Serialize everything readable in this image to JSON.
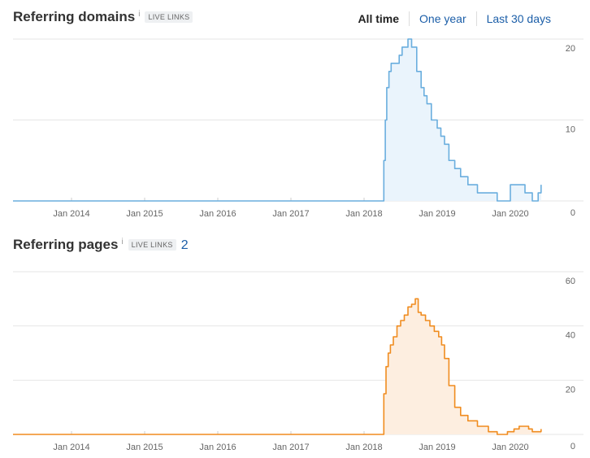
{
  "header": {
    "domains_title": "Referring domains",
    "info_glyph": "i",
    "live_badge": "LIVE LINKS",
    "pages_title": "Referring pages",
    "pages_count": "2"
  },
  "time_range": {
    "options": [
      "All time",
      "One year",
      "Last 30 days"
    ],
    "selected": "All time"
  },
  "chart_data": [
    {
      "type": "area",
      "title": "Referring domains",
      "color": "#6aaede",
      "fill": "#eaf4fc",
      "x_ticks": [
        "Jan 2014",
        "Jan 2015",
        "Jan 2016",
        "Jan 2017",
        "Jan 2018",
        "Jan 2019",
        "Jan 2020"
      ],
      "y_ticks": [
        "0",
        "10",
        "20"
      ],
      "ylim": [
        0,
        20
      ],
      "xlim": [
        2013.2,
        2020.6
      ],
      "grid": true,
      "series": [
        {
          "x": [
            2013.2,
            2018.25,
            2018.27,
            2018.29,
            2018.31,
            2018.34,
            2018.37,
            2018.42,
            2018.48,
            2018.52,
            2018.56,
            2018.6,
            2018.65,
            2018.72,
            2018.78,
            2018.82,
            2018.86,
            2018.92,
            2018.96,
            2019.0,
            2019.05,
            2019.1,
            2019.16,
            2019.24,
            2019.32,
            2019.42,
            2019.55,
            2019.65,
            2019.82,
            2019.95,
            2020.0,
            2020.1,
            2020.2,
            2020.25,
            2020.3,
            2020.35,
            2020.38,
            2020.42
          ],
          "y": [
            0,
            0,
            5,
            10,
            14,
            16,
            17,
            17,
            18,
            19,
            19,
            20,
            19,
            16,
            14,
            13,
            12,
            10,
            10,
            9,
            8,
            7,
            5,
            4,
            3,
            2,
            1,
            1,
            0,
            0,
            2,
            2,
            1,
            1,
            0,
            0,
            1,
            2
          ]
        }
      ]
    },
    {
      "type": "area",
      "title": "Referring pages",
      "color": "#f08c1f",
      "fill": "#fdeee0",
      "x_ticks": [
        "Jan 2014",
        "Jan 2015",
        "Jan 2016",
        "Jan 2017",
        "Jan 2018",
        "Jan 2019",
        "Jan 2020"
      ],
      "y_ticks": [
        "0",
        "20",
        "40",
        "60"
      ],
      "ylim": [
        0,
        60
      ],
      "xlim": [
        2013.2,
        2020.6
      ],
      "grid": true,
      "series": [
        {
          "x": [
            2013.2,
            2018.25,
            2018.27,
            2018.3,
            2018.33,
            2018.36,
            2018.4,
            2018.45,
            2018.5,
            2018.55,
            2018.6,
            2018.65,
            2018.7,
            2018.74,
            2018.78,
            2018.84,
            2018.9,
            2018.96,
            2019.02,
            2019.06,
            2019.1,
            2019.16,
            2019.24,
            2019.32,
            2019.42,
            2019.55,
            2019.7,
            2019.82,
            2019.9,
            2019.96,
            2020.05,
            2020.12,
            2020.18,
            2020.25,
            2020.3,
            2020.35,
            2020.4,
            2020.42
          ],
          "y": [
            0,
            0,
            15,
            25,
            30,
            33,
            36,
            40,
            42,
            44,
            47,
            48,
            50,
            45,
            44,
            42,
            40,
            38,
            36,
            33,
            28,
            18,
            10,
            7,
            5,
            3,
            1,
            0,
            0,
            1,
            2,
            3,
            3,
            2,
            1,
            1,
            1,
            2
          ]
        }
      ]
    }
  ]
}
